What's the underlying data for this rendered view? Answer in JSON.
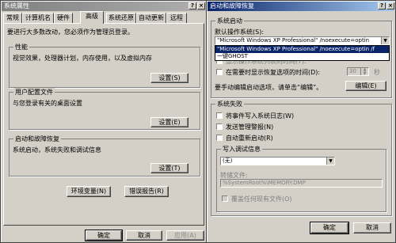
{
  "sysprops": {
    "title": "系统属性",
    "tabs": [
      "常规",
      "计算机名",
      "硬件",
      "高级",
      "系统还原",
      "自动更新",
      "远程"
    ],
    "intro": "要进行大多数改动，您必须作为管理员登录。",
    "perf": {
      "label": "性能",
      "desc": "视觉效果，处理器计划，内存使用，以及虚拟内存",
      "btn": "设置(S)"
    },
    "profile": {
      "label": "用户配置文件",
      "desc": "与您登录有关的桌面设置",
      "btn": "设置(E)"
    },
    "startup": {
      "label": "启动和故障恢复",
      "desc": "系统启动，系统失败和调试信息",
      "btn": "设置(T)"
    },
    "env_btn": "环境变量(N)",
    "err_btn": "错误报告(R)",
    "ok": "确定",
    "cancel": "取消",
    "apply": "应用(A)"
  },
  "startup_dialog": {
    "title": "启动和故障恢复",
    "sys_startup_label": "系统启动",
    "default_os_label": "默认操作系统(S):",
    "default_os_value": "\"Microsoft Windows XP Professional\" /noexecute=optin",
    "dropdown_items": [
      "\"Microsoft Windows XP Professional\" /noexecute=optin /f",
      "一键GHOST"
    ],
    "show_os_list_label": "显示操作系统列表的时间(T):",
    "show_recovery_label": "在需要时显示恢复选项的时间(D):",
    "recovery_seconds": "30",
    "seconds_unit": "秒",
    "edit_hint": "要手动编辑启动选项，请单击“编辑”。",
    "edit_btn": "编辑(E)",
    "sys_failure_label": "系统失败",
    "write_event_label": "将事件写入系统日志(W)",
    "send_alert_label": "发送管理警报(N)",
    "auto_restart_label": "自动重新启动(R)",
    "debug_label": "写入调试信息",
    "debug_value": "(无)",
    "dump_label": "转储文件:",
    "dump_value": "%SystemRoot%\\MEMORY.DMP",
    "overwrite_label": "覆盖任何现有文件(O)",
    "ok": "确定",
    "cancel": "取消"
  }
}
